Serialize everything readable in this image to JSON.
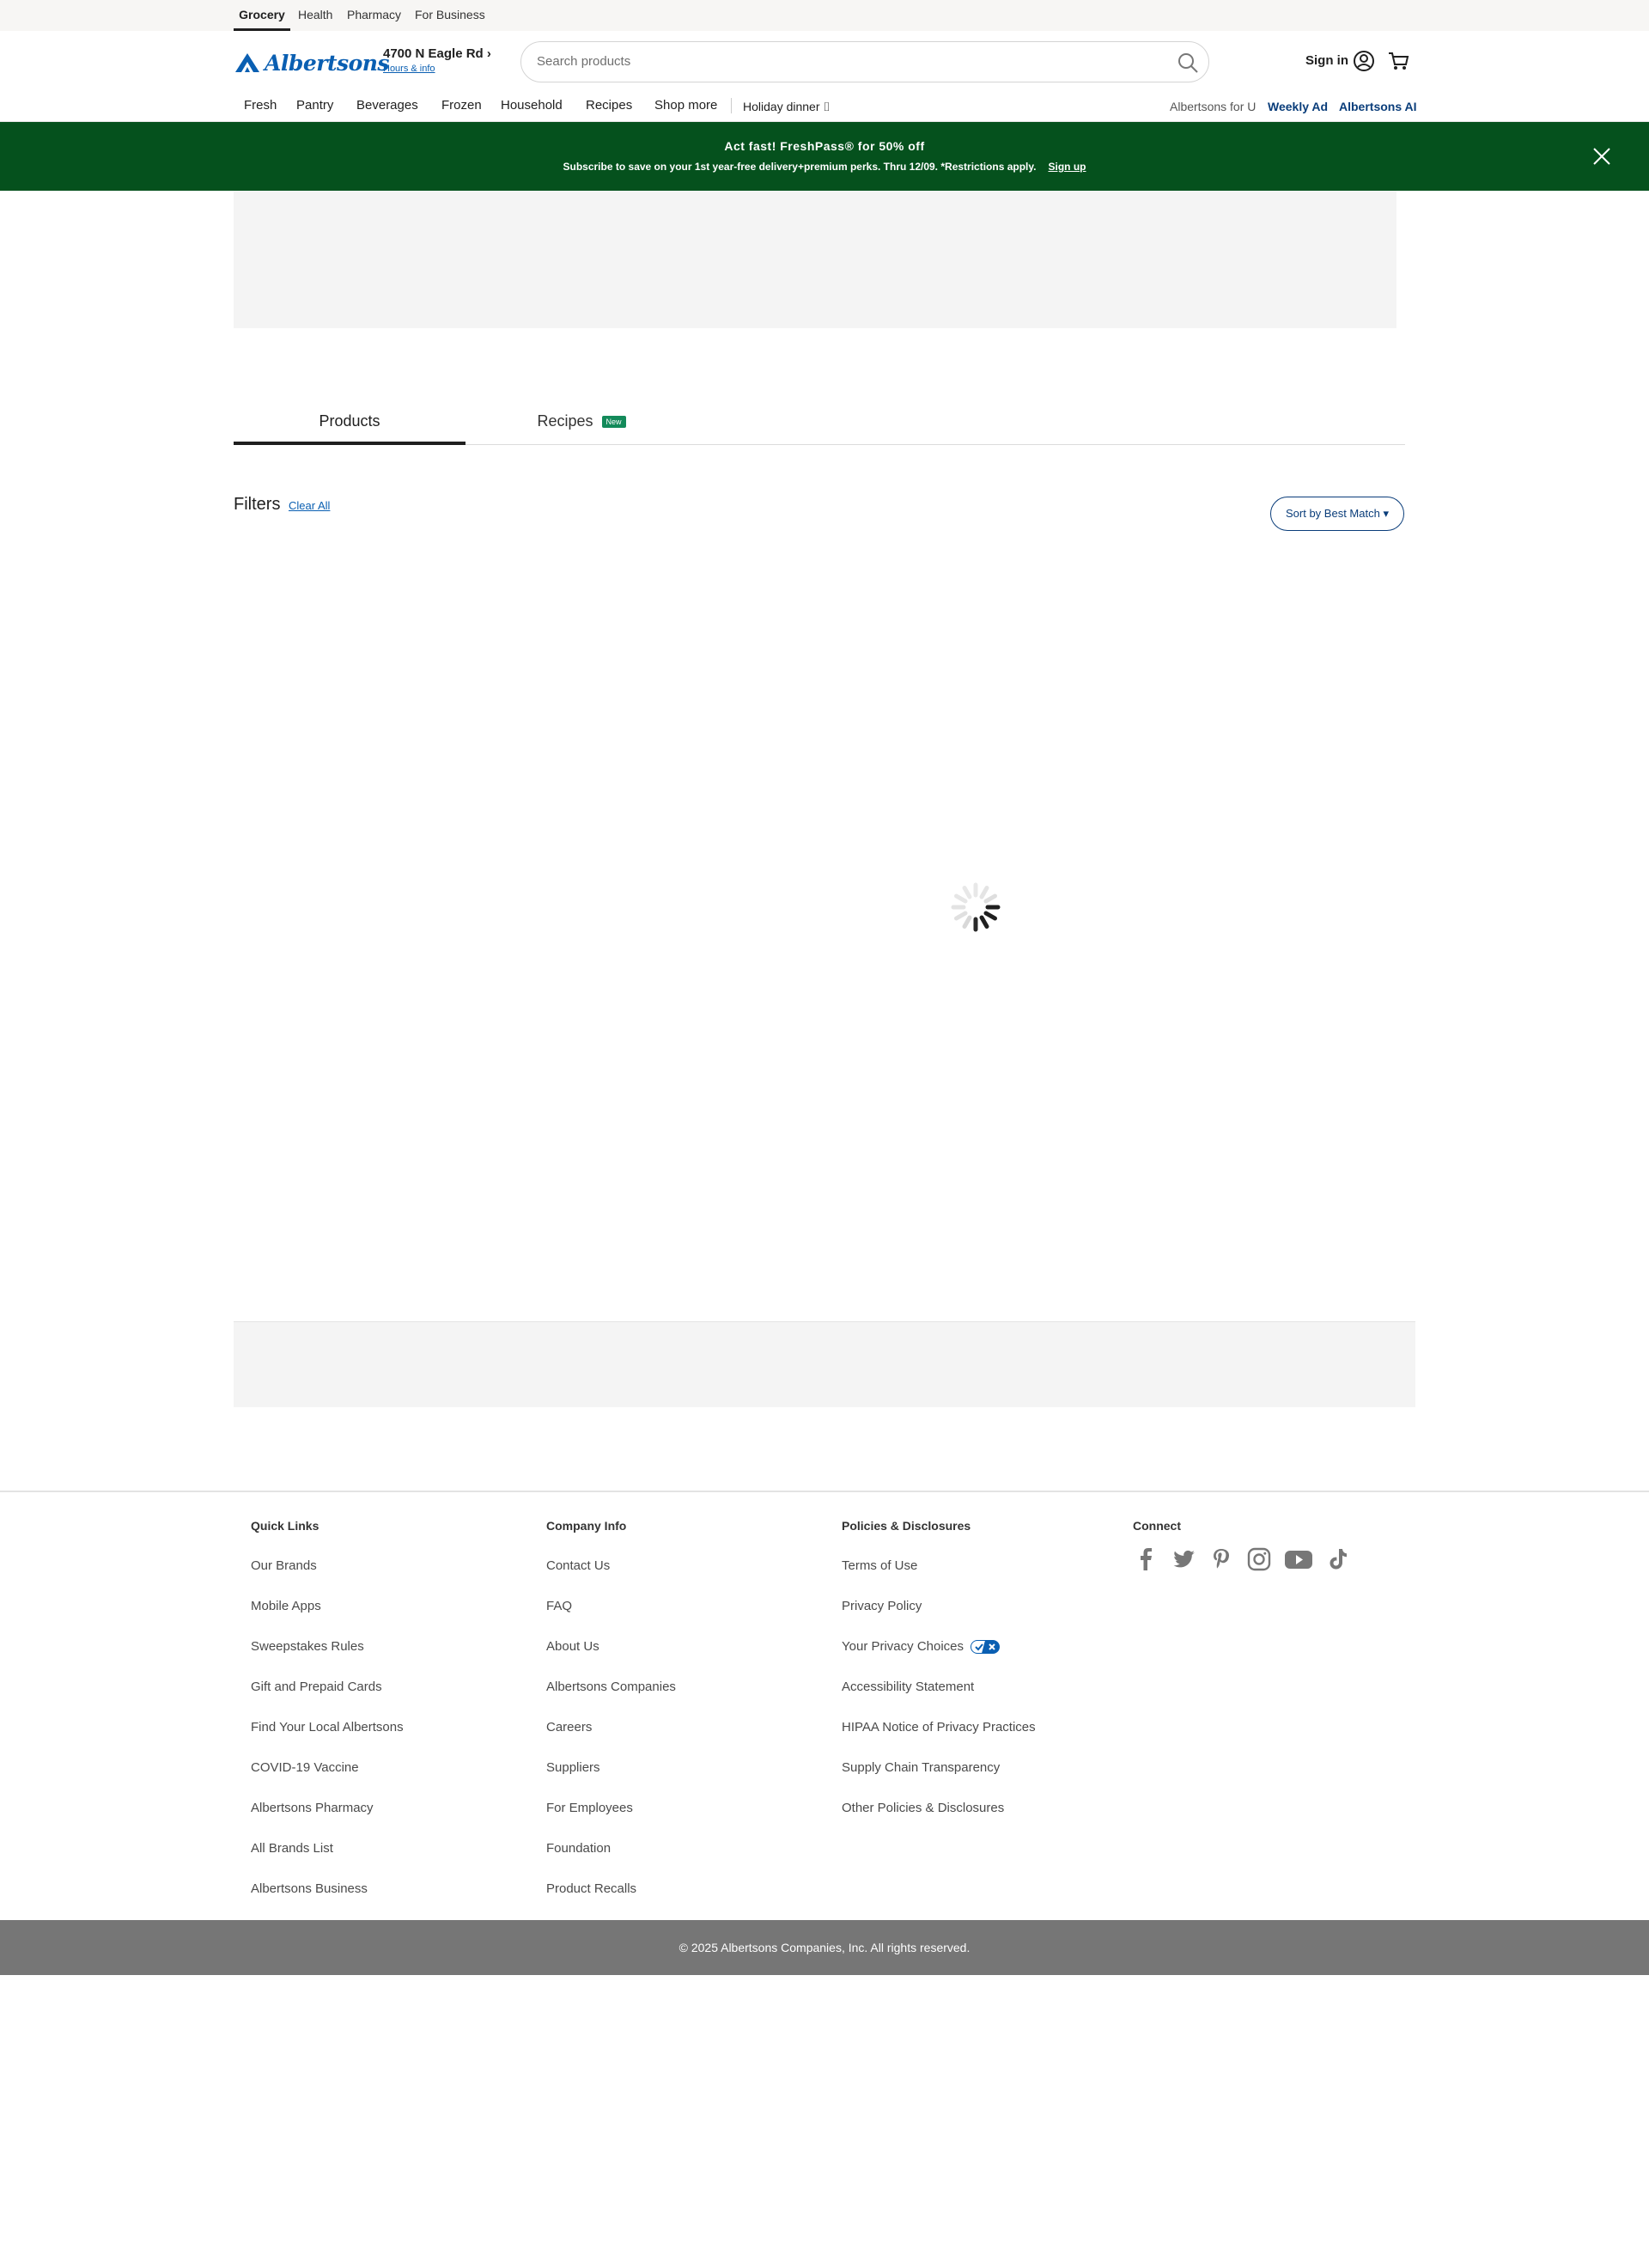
{
  "util_bar": {
    "tabs": [
      "Grocery",
      "Health",
      "Pharmacy",
      "For Business"
    ],
    "active": "Grocery"
  },
  "header": {
    "logo_text": "Albertsons",
    "store_address": "4700 N Eagle Rd",
    "store_link": "Hours & info",
    "search_placeholder": "Search products",
    "signin_label": "Sign in"
  },
  "nav": {
    "items": [
      "Fresh",
      "Pantry",
      "Beverages",
      "Frozen",
      "Household",
      "Recipes",
      "Shop more"
    ],
    "holiday": "Holiday dinner ⌷",
    "right_links": [
      "Albertsons for U",
      "Weekly Ad",
      "Albertsons AI"
    ]
  },
  "promo": {
    "title": "Act fast! FreshPass® for 50% off",
    "subtitle": "Subscribe to save on your 1st year-free delivery+premium perks. Thru 12/09. *Restrictions apply.",
    "link": "Sign up",
    "bg_color": "#05511d"
  },
  "tabs": {
    "products": "Products",
    "recipes": "Recipes",
    "recipes_badge": "New"
  },
  "filters": {
    "label": "Filters",
    "clear_all": "Clear All",
    "sort_label": "Sort by Best Match"
  },
  "footer": {
    "quick_links": {
      "heading": "Quick Links",
      "items": [
        "Our Brands",
        "Mobile Apps",
        "Sweepstakes Rules",
        "Gift and Prepaid Cards",
        "Find Your Local Albertsons",
        "COVID-19 Vaccine",
        "Albertsons Pharmacy",
        "All Brands List",
        "Albertsons Business"
      ]
    },
    "company_info": {
      "heading": "Company Info",
      "items": [
        "Contact Us",
        "FAQ",
        "About Us",
        "Albertsons Companies",
        "Careers",
        "Suppliers",
        "For Employees",
        "Foundation",
        "Product Recalls"
      ]
    },
    "policies": {
      "heading": "Policies & Disclosures",
      "items": [
        "Terms of Use",
        "Privacy Policy",
        "Your Privacy Choices",
        "Accessibility Statement",
        "HIPAA Notice of Privacy Practices",
        "Supply Chain Transparency",
        "Other Policies & Disclosures"
      ]
    },
    "connect": {
      "heading": "Connect",
      "icons": [
        "facebook-icon",
        "twitter-icon",
        "pinterest-icon",
        "instagram-icon",
        "youtube-icon",
        "tiktok-icon"
      ]
    },
    "copyright": "© 2025 Albertsons Companies, Inc.  All rights reserved."
  },
  "colors": {
    "brand_blue": "#0a5fb2",
    "nav_dark_blue": "#0a3d7a",
    "footer_bar": "#767676"
  }
}
